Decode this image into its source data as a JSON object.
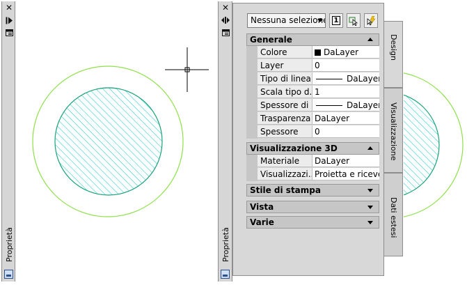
{
  "left_palette": {
    "title": "Proprietà",
    "close_icon": "close-icon",
    "toggle_icon": "toggle-properties-icon",
    "menu_icon": "properties-menu-icon"
  },
  "right_palette": {
    "title": "Proprietà",
    "close_icon": "close-icon",
    "autohide_icon": "autohide-icon",
    "menu_icon": "properties-menu-icon"
  },
  "toolbar": {
    "selection_value": "Nessuna selezione",
    "toggle_pickadd_label": "1",
    "select_objects_icon": "select-objects-icon",
    "quick_select_icon": "quick-select-icon"
  },
  "sections": {
    "generale": {
      "title": "Generale",
      "rows": [
        {
          "label": "Colore",
          "value": "DaLayer"
        },
        {
          "label": "Layer",
          "value": "0"
        },
        {
          "label": "Tipo di linea",
          "value": "DaLayer"
        },
        {
          "label": "Scala tipo d...",
          "value": "1"
        },
        {
          "label": "Spessore di ...",
          "value": "DaLayer"
        },
        {
          "label": "Trasparenza",
          "value": "DaLayer"
        },
        {
          "label": "Spessore",
          "value": "0"
        }
      ]
    },
    "vis3d": {
      "title": "Visualizzazione 3D",
      "rows": [
        {
          "label": "Materiale",
          "value": "DaLayer"
        },
        {
          "label": "Visualizzazi...",
          "value": "Proietta e riceve..."
        }
      ]
    },
    "stile": {
      "title": "Stile di stampa"
    },
    "vista": {
      "title": "Vista"
    },
    "varie": {
      "title": "Varie"
    }
  },
  "tabs": {
    "design": "Design",
    "visualizzazione": "Visualizzazione",
    "dati_estesi": "Dati estesi"
  },
  "colors": {
    "circle_outer": "#8ee04a",
    "circle_inner_stroke": "#1aa37a",
    "hatch": "#33cccc",
    "panel_bg": "#d8d8d8"
  }
}
